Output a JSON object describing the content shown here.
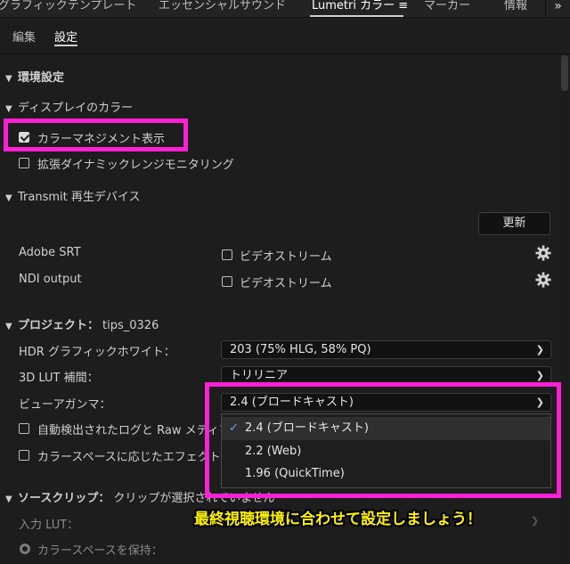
{
  "tabs": {
    "items": [
      "グラフィックテンプレート",
      "エッセンシャルサウンド",
      "Lumetri カラー ≡",
      "マーカー",
      "情報"
    ],
    "overflow": "»"
  },
  "subtabs": {
    "edit": "編集",
    "settings": "設定"
  },
  "sections": {
    "preferences": "環境設定",
    "display_color": "ディスプレイのカラー",
    "transmit": "Transmit 再生デバイス",
    "project": "プロジェクト：",
    "project_name": "tips_0326",
    "source_clip": "ソースクリップ：",
    "source_clip_status": "クリップが選択されていません"
  },
  "display_color": {
    "color_management": {
      "label": "カラーマネジメント表示",
      "checked": true
    },
    "extended_dynamic": {
      "label": "拡張ダイナミックレンジモニタリング",
      "checked": false
    }
  },
  "transmit": {
    "update_button": "更新",
    "devices": [
      {
        "name": "Adobe SRT",
        "option": "ビデオストリーム",
        "checked": false
      },
      {
        "name": "NDI output",
        "option": "ビデオストリーム",
        "checked": false
      }
    ]
  },
  "project": {
    "hdr_label": "HDR グラフィックホワイト：",
    "hdr_value": "203 (75% HLG, 58% PQ)",
    "lut_label": "3D LUT 補間：",
    "lut_value": "トリリニア",
    "gamma_label": "ビューアガンマ：",
    "gamma_value": "2.4 (ブロードキャスト)",
    "auto_log_label": "自動検出されたログと Raw メディア",
    "colorspace_effect_label": "カラースペースに応じたエフェクト"
  },
  "gamma_options": [
    {
      "label": "2.4 (ブロードキャスト)",
      "selected": true
    },
    {
      "label": "2.2 (Web)",
      "selected": false
    },
    {
      "label": "1.96 (QuickTime)",
      "selected": false
    }
  ],
  "source_clip": {
    "input_lut_label": "入力 LUT：",
    "keep_colorspace_label": "カラースペースを保持："
  },
  "annotation": "最終視聴環境に合わせて設定しましょう！",
  "colors": {
    "highlight": "#ff1fd5",
    "annotation": "#fff200",
    "check_accent": "#5da9ff",
    "background": "#1d1d1d"
  }
}
